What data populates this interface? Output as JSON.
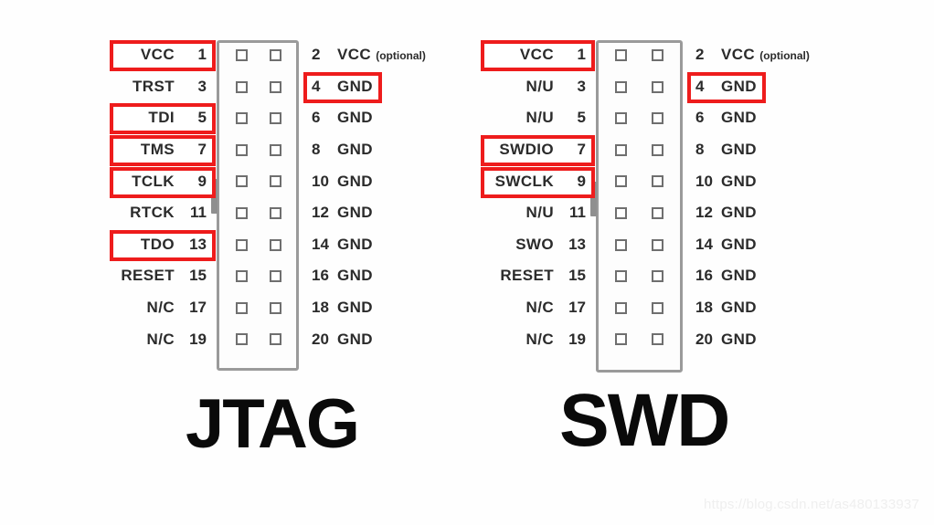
{
  "page": {
    "background_color": "#fefefe",
    "highlight_color": "#ee1c1c",
    "text_color": "#2b2b2b",
    "shell_color": "#9a9a9a"
  },
  "watermark": {
    "text": "https://blog.csdn.net/as480133937"
  },
  "connectors": [
    {
      "id": "jtag",
      "caption": "JTAG",
      "pin_count": 20,
      "rows": [
        {
          "left_signal": "VCC",
          "left_pin": "1",
          "left_highlight": true,
          "right_pin": "2",
          "right_signal": "VCC",
          "right_note": "(optional)",
          "right_highlight": false
        },
        {
          "left_signal": "TRST",
          "left_pin": "3",
          "left_highlight": false,
          "right_pin": "4",
          "right_signal": "GND",
          "right_note": "",
          "right_highlight": true
        },
        {
          "left_signal": "TDI",
          "left_pin": "5",
          "left_highlight": true,
          "right_pin": "6",
          "right_signal": "GND",
          "right_note": "",
          "right_highlight": false
        },
        {
          "left_signal": "TMS",
          "left_pin": "7",
          "left_highlight": true,
          "right_pin": "8",
          "right_signal": "GND",
          "right_note": "",
          "right_highlight": false
        },
        {
          "left_signal": "TCLK",
          "left_pin": "9",
          "left_highlight": true,
          "right_pin": "10",
          "right_signal": "GND",
          "right_note": "",
          "right_highlight": false
        },
        {
          "left_signal": "RTCK",
          "left_pin": "11",
          "left_highlight": false,
          "right_pin": "12",
          "right_signal": "GND",
          "right_note": "",
          "right_highlight": false
        },
        {
          "left_signal": "TDO",
          "left_pin": "13",
          "left_highlight": true,
          "right_pin": "14",
          "right_signal": "GND",
          "right_note": "",
          "right_highlight": false
        },
        {
          "left_signal": "RESET",
          "left_pin": "15",
          "left_highlight": false,
          "right_pin": "16",
          "right_signal": "GND",
          "right_note": "",
          "right_highlight": false
        },
        {
          "left_signal": "N/C",
          "left_pin": "17",
          "left_highlight": false,
          "right_pin": "18",
          "right_signal": "GND",
          "right_note": "",
          "right_highlight": false
        },
        {
          "left_signal": "N/C",
          "left_pin": "19",
          "left_highlight": false,
          "right_pin": "20",
          "right_signal": "GND",
          "right_note": "",
          "right_highlight": false
        }
      ]
    },
    {
      "id": "swd",
      "caption": "SWD",
      "pin_count": 20,
      "rows": [
        {
          "left_signal": "VCC",
          "left_pin": "1",
          "left_highlight": true,
          "right_pin": "2",
          "right_signal": "VCC",
          "right_note": "(optional)",
          "right_highlight": false
        },
        {
          "left_signal": "N/U",
          "left_pin": "3",
          "left_highlight": false,
          "right_pin": "4",
          "right_signal": "GND",
          "right_note": "",
          "right_highlight": true
        },
        {
          "left_signal": "N/U",
          "left_pin": "5",
          "left_highlight": false,
          "right_pin": "6",
          "right_signal": "GND",
          "right_note": "",
          "right_highlight": false
        },
        {
          "left_signal": "SWDIO",
          "left_pin": "7",
          "left_highlight": true,
          "right_pin": "8",
          "right_signal": "GND",
          "right_note": "",
          "right_highlight": false
        },
        {
          "left_signal": "SWCLK",
          "left_pin": "9",
          "left_highlight": true,
          "right_pin": "10",
          "right_signal": "GND",
          "right_note": "",
          "right_highlight": false
        },
        {
          "left_signal": "N/U",
          "left_pin": "11",
          "left_highlight": false,
          "right_pin": "12",
          "right_signal": "GND",
          "right_note": "",
          "right_highlight": false
        },
        {
          "left_signal": "SWO",
          "left_pin": "13",
          "left_highlight": false,
          "right_pin": "14",
          "right_signal": "GND",
          "right_note": "",
          "right_highlight": false
        },
        {
          "left_signal": "RESET",
          "left_pin": "15",
          "left_highlight": false,
          "right_pin": "16",
          "right_signal": "GND",
          "right_note": "",
          "right_highlight": false
        },
        {
          "left_signal": "N/C",
          "left_pin": "17",
          "left_highlight": false,
          "right_pin": "18",
          "right_signal": "GND",
          "right_note": "",
          "right_highlight": false
        },
        {
          "left_signal": "N/C",
          "left_pin": "19",
          "left_highlight": false,
          "right_pin": "20",
          "right_signal": "GND",
          "right_note": "",
          "right_highlight": false
        }
      ]
    }
  ]
}
